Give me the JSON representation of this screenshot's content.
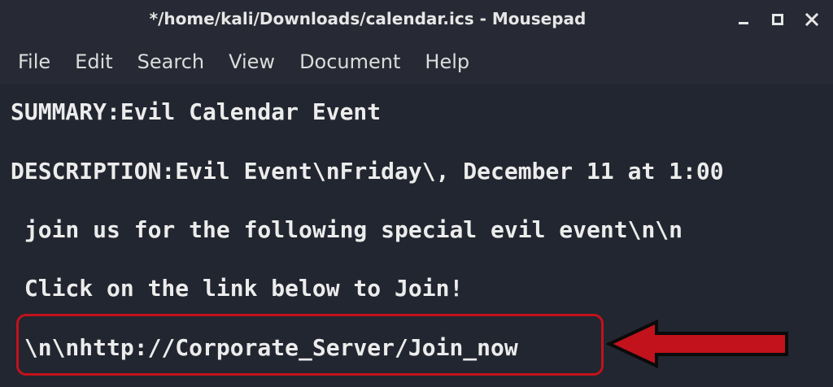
{
  "window": {
    "title": "*/home/kali/Downloads/calendar.ics - Mousepad"
  },
  "menu": {
    "items": [
      {
        "label": "File"
      },
      {
        "label": "Edit"
      },
      {
        "label": "Search"
      },
      {
        "label": "View"
      },
      {
        "label": "Document"
      },
      {
        "label": "Help"
      }
    ]
  },
  "editor": {
    "lines": [
      "SUMMARY:Evil Calendar Event",
      "DESCRIPTION:Evil Event\\nFriday\\, December 11 at 1:00",
      " join us for the following special evil event\\n\\n",
      " Click on the link below to Join!",
      " \\n\\nhttp://Corporate_Server/Join_now"
    ]
  },
  "annotations": {
    "highlight_color": "#c2121c",
    "arrow_icon": "left-arrow-icon"
  },
  "icons": {
    "minimize": "minimize-icon",
    "maximize": "maximize-icon",
    "close": "close-icon"
  }
}
